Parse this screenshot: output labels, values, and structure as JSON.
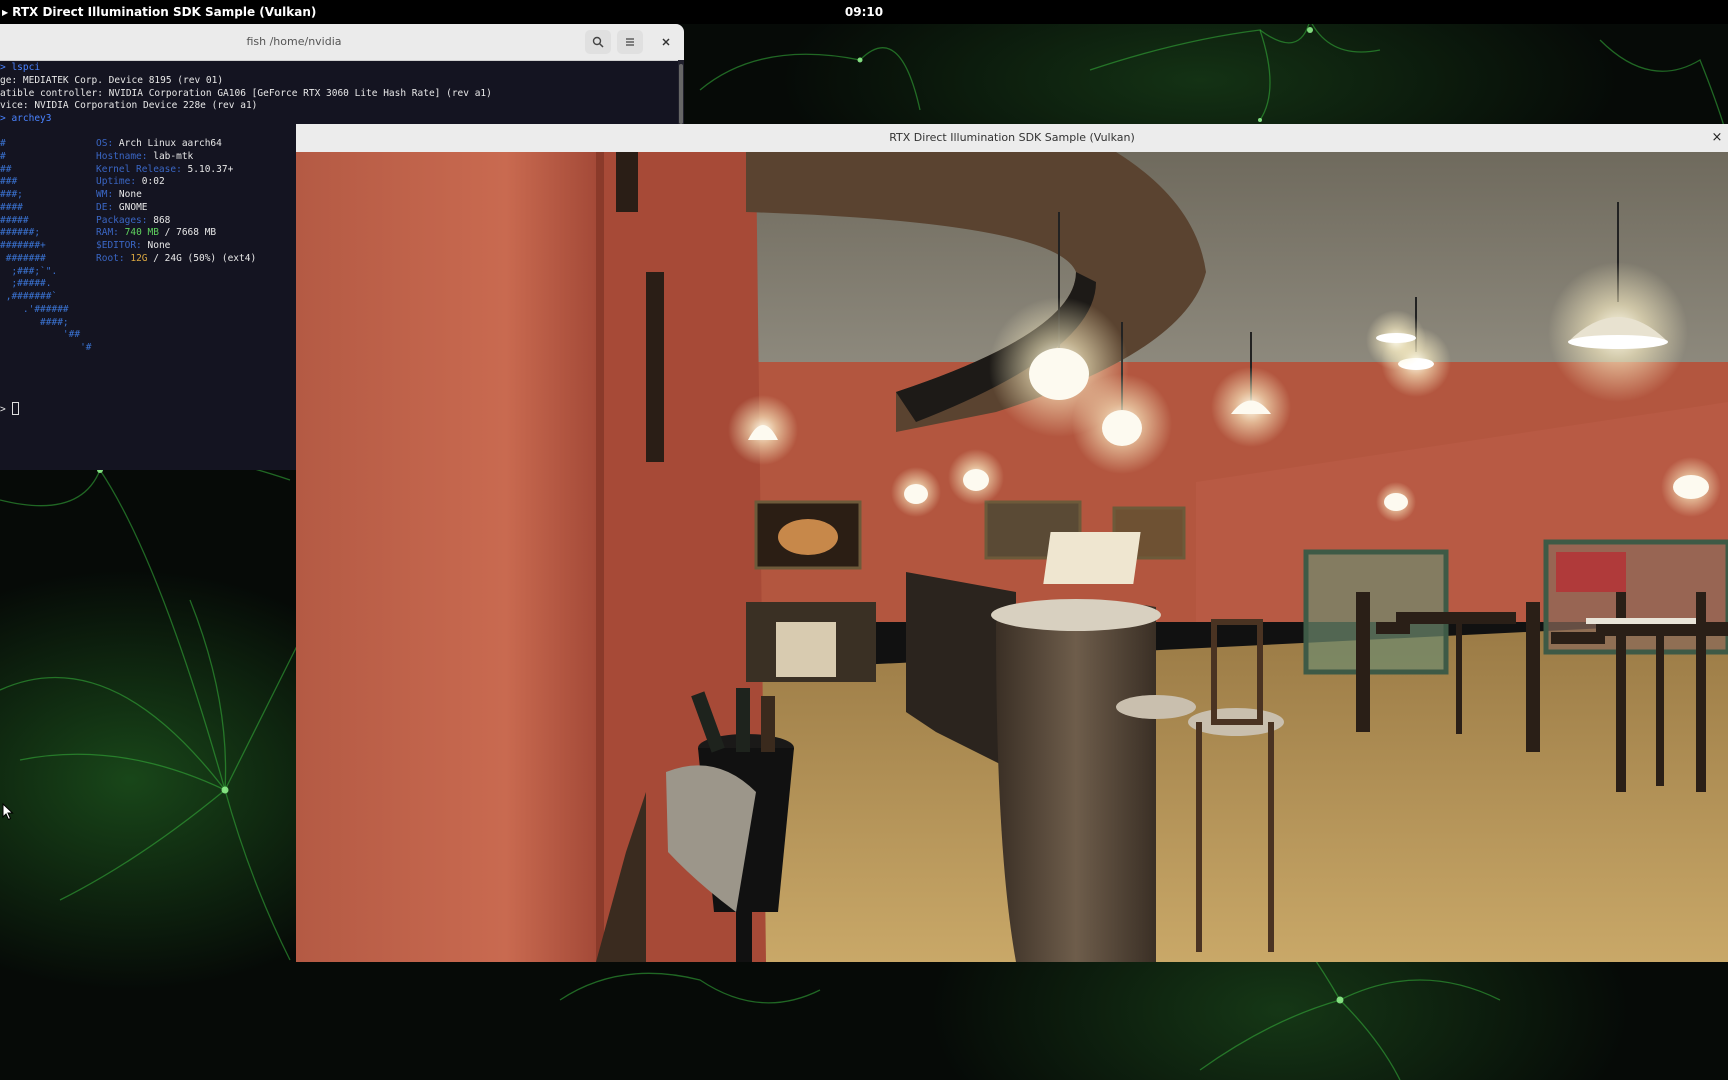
{
  "topbar": {
    "app_menu_label": "RTX Direct Illumination SDK Sample (Vulkan)",
    "clock": "09:10"
  },
  "terminal": {
    "title": "fish /home/nvidia",
    "icons": [
      "search-icon",
      "hamburger-menu-icon",
      "close-icon"
    ],
    "lines": {
      "l1": "> lspci",
      "l2": "ge: MEDIATEK Corp. Device 8195 (rev 01)",
      "l3": "atible controller: NVIDIA Corporation GA106 [GeForce RTX 3060 Lite Hash Rate] (rev a1)",
      "l4": "vice: NVIDIA Corporation Device 228e (rev a1)",
      "l5": "> archey3",
      "prompt": ">"
    },
    "archey": {
      "os_label": "OS:",
      "os_value": "Arch Linux aarch64",
      "hostname_label": "Hostname:",
      "hostname_value": "lab-mtk",
      "kernel_label": "Kernel Release:",
      "kernel_value": "5.10.37+",
      "uptime_label": "Uptime:",
      "uptime_value": "0:02",
      "wm_label": "WM:",
      "wm_value": "None",
      "de_label": "DE:",
      "de_value": "GNOME",
      "packages_label": "Packages:",
      "packages_value": "868",
      "ram_label": "RAM:",
      "ram_used": "740 MB",
      "ram_total": " / 7668 MB",
      "editor_label": "$EDITOR:",
      "editor_value": "None",
      "root_label": "Root:",
      "root_used": "12G",
      "root_total": " / 24G (50%) (ext4)"
    },
    "ascii_art": [
      "#",
      "#",
      "##",
      "###",
      "###;",
      "####",
      "#####",
      "######;",
      "#######+",
      " #######",
      "  ;###;`\".",
      "  ;#####.",
      " ,#######`",
      "    .'######",
      "       ####;",
      "           '##",
      "              '#"
    ]
  },
  "vulkan_window": {
    "title": "RTX Direct Illumination SDK Sample (Vulkan)",
    "close_glyph": "×",
    "scene": "restaurant-bistro-render"
  },
  "colors": {
    "topbar_bg": "#000000",
    "terminal_bg": "#141421",
    "terminal_accent": "#3a66c4",
    "wallpaper_green": "#3fd44a"
  }
}
